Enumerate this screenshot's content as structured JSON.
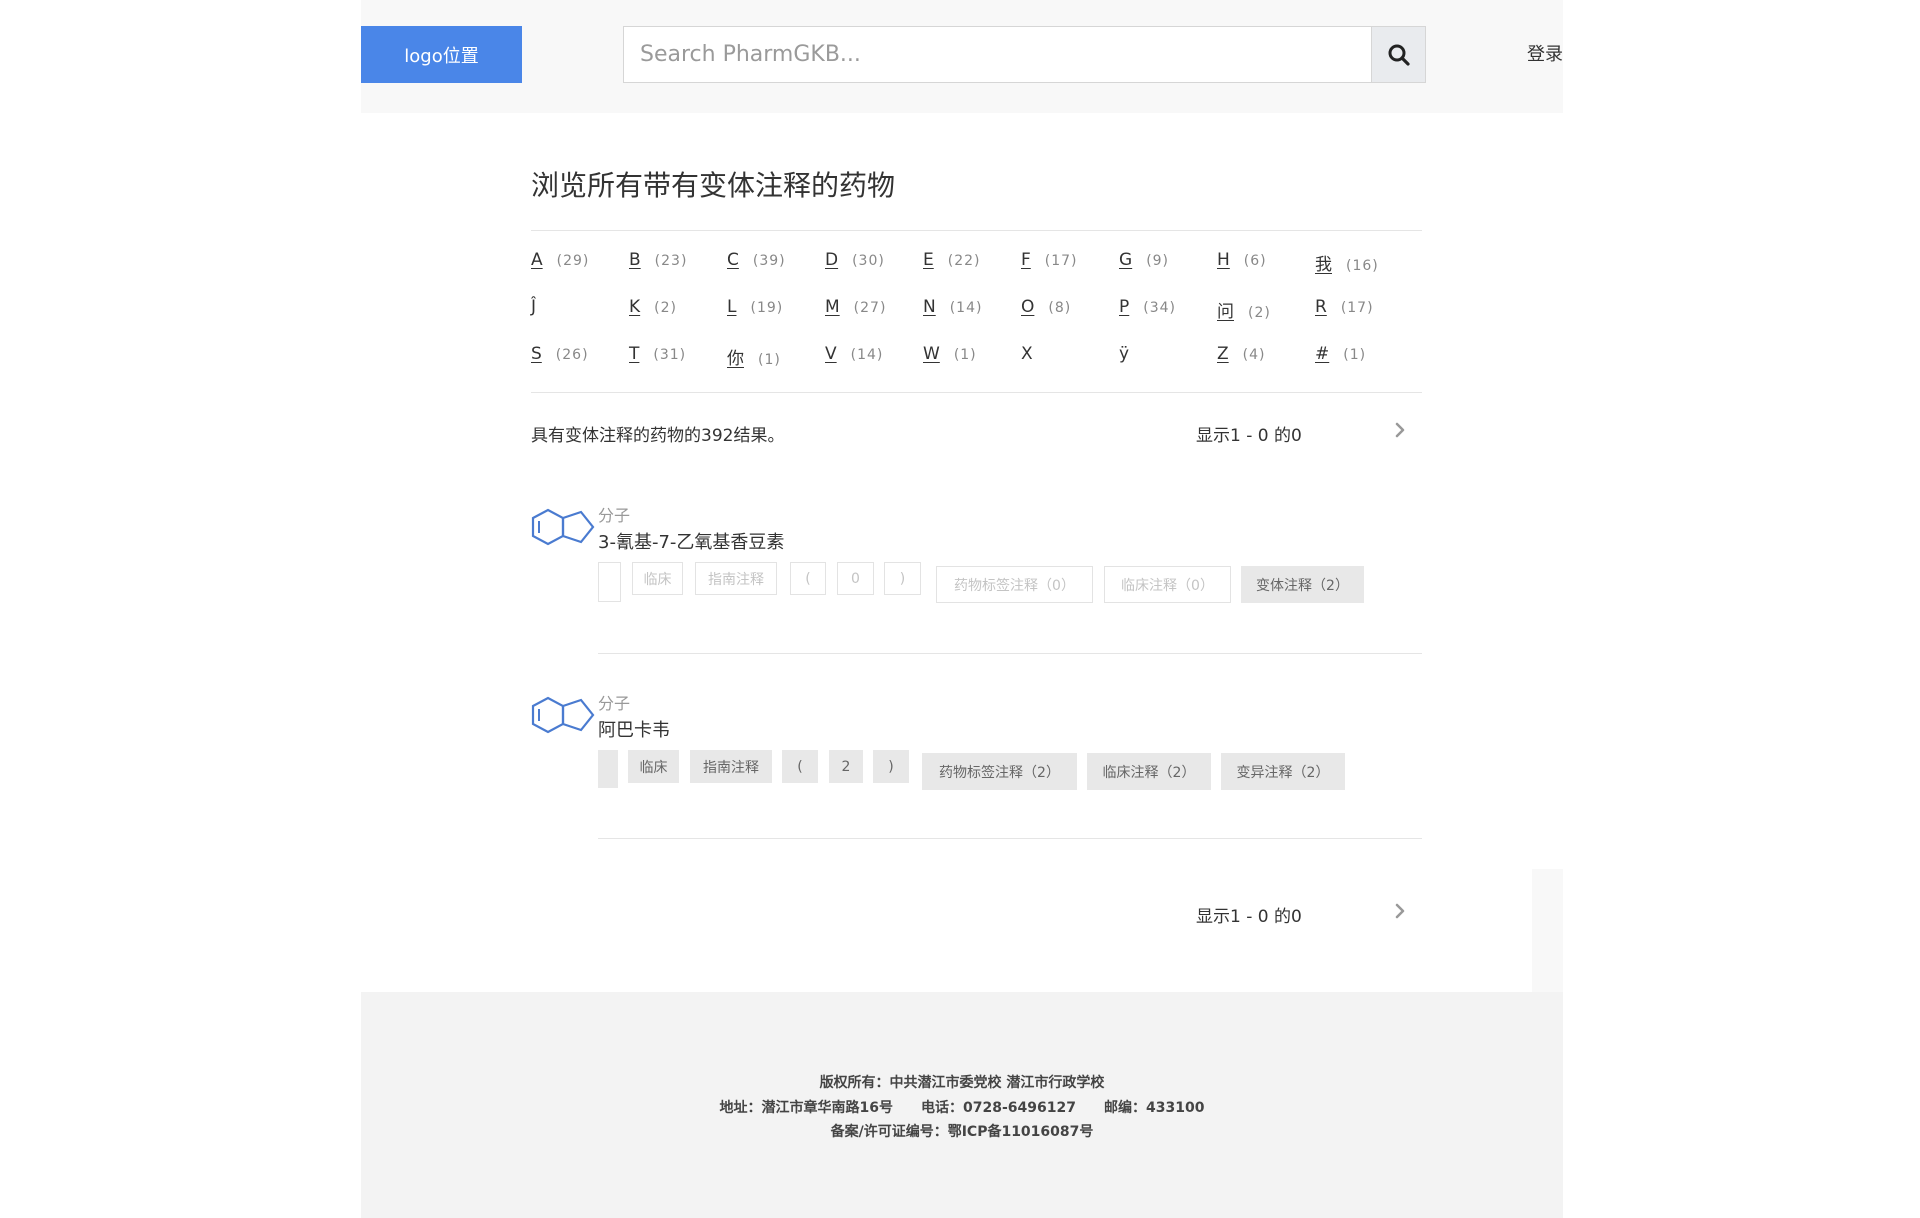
{
  "header": {
    "logo": "logo位置",
    "search_placeholder": "Search PharmGKB...",
    "login": "登录"
  },
  "main": {
    "title": "浏览所有带有变体注释的药物",
    "alphabet": [
      [
        {
          "letter": "A",
          "count": "(29)"
        },
        {
          "letter": "B",
          "count": "(23)"
        },
        {
          "letter": "C",
          "count": "(39)"
        },
        {
          "letter": "D",
          "count": "(30)"
        },
        {
          "letter": "E",
          "count": "(22)"
        },
        {
          "letter": "F",
          "count": "(17)"
        },
        {
          "letter": "G",
          "count": "(9)"
        },
        {
          "letter": "H",
          "count": "(6)"
        },
        {
          "letter": "我",
          "count": "(16)"
        }
      ],
      [
        {
          "letter": "Ĵ",
          "count": ""
        },
        {
          "letter": "K",
          "count": "(2)"
        },
        {
          "letter": "L",
          "count": "(19)"
        },
        {
          "letter": "M",
          "count": "(27)"
        },
        {
          "letter": "N",
          "count": "(14)"
        },
        {
          "letter": "O",
          "count": "(8)"
        },
        {
          "letter": "P",
          "count": "(34)"
        },
        {
          "letter": "问",
          "count": "(2)"
        },
        {
          "letter": "R",
          "count": "(17)"
        }
      ],
      [
        {
          "letter": "S",
          "count": "(26)"
        },
        {
          "letter": "T",
          "count": "(31)"
        },
        {
          "letter": "你",
          "count": "(1)"
        },
        {
          "letter": "V",
          "count": "(14)"
        },
        {
          "letter": "W",
          "count": "(1)"
        },
        {
          "letter": "X",
          "count": ""
        },
        {
          "letter": "ÿ",
          "count": ""
        },
        {
          "letter": "Z",
          "count": "(4)"
        },
        {
          "letter": "#",
          "count": "(1)"
        }
      ]
    ],
    "results_summary": "具有变体注释的药物的392结果。",
    "pager_text": "显示1 - 0 的0"
  },
  "results": [
    {
      "type": "分子",
      "name": "3-氰基-7-乙氧基香豆素",
      "tags": [
        {
          "label": ""
        },
        {
          "label": "临床"
        },
        {
          "label": "指南注释"
        },
        {
          "label": "("
        },
        {
          "label": "0"
        },
        {
          "label": ")"
        },
        {
          "label": "药物标签注释（0）"
        },
        {
          "label": "临床注释（0）"
        },
        {
          "label": "变体注释（2）"
        }
      ]
    },
    {
      "type": "分子",
      "name": "阿巴卡韦",
      "tags": [
        {
          "label": ""
        },
        {
          "label": "临床"
        },
        {
          "label": "指南注释"
        },
        {
          "label": "("
        },
        {
          "label": "2"
        },
        {
          "label": ")"
        },
        {
          "label": "药物标签注释（2）"
        },
        {
          "label": "临床注释（2）"
        },
        {
          "label": "变异注释（2）"
        }
      ]
    }
  ],
  "footer": {
    "copyright": "版权所有：中共潜江市委党校 潜江市行政学校",
    "address": "地址：潜江市章华南路16号　　电话：0728-6496127　　邮编：433100",
    "license": "备案/许可证编号：鄂ICP备11016087号"
  },
  "colors": {
    "logo_bg": "#4a86e8",
    "molecule_icon": "#4a7bd0",
    "header_bg": "#f8f8f8",
    "footer_bg": "#f3f3f3"
  }
}
